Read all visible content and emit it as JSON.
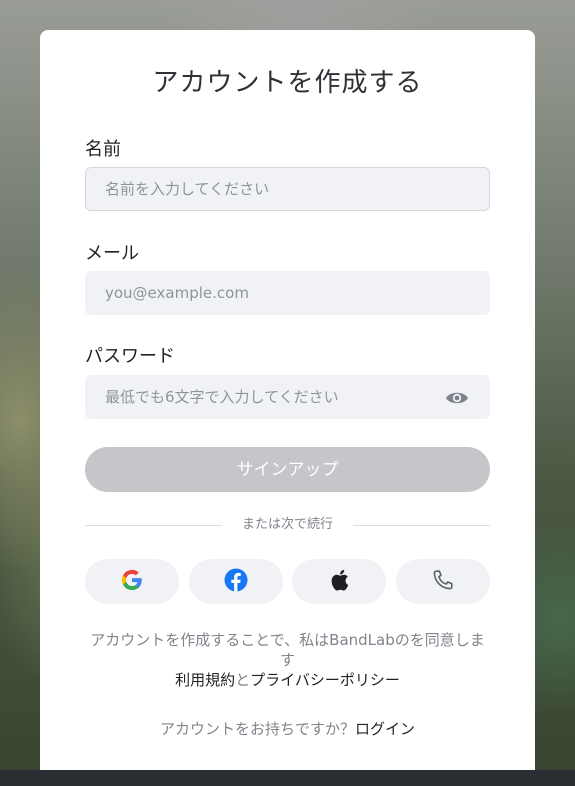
{
  "page": {
    "title": "アカウントを作成する"
  },
  "form": {
    "name_label": "名前",
    "name_placeholder": "名前を入力してください",
    "email_label": "メール",
    "email_placeholder": "you@example.com",
    "password_label": "パスワード",
    "password_placeholder": "最低でも6文字で入力してください",
    "signup_label": "サインアップ"
  },
  "divider": {
    "text": "または次で続行"
  },
  "social": {
    "items": [
      {
        "icon": "google-icon"
      },
      {
        "icon": "facebook-icon"
      },
      {
        "icon": "apple-icon"
      },
      {
        "icon": "phone-icon"
      }
    ]
  },
  "terms": {
    "text": "アカウントを作成することで、私はBandLabのを同意します",
    "terms_link": "利用規約",
    "and": "と",
    "privacy_link": "プライバシーポリシー"
  },
  "login": {
    "prompt": "アカウントをお持ちですか？",
    "link": "ログイン"
  },
  "colors": {
    "field_bg": "#f0f2f5",
    "button_disabled": "#c4c6c9",
    "text_dark": "#1f2126",
    "text_muted": "#80858c"
  }
}
